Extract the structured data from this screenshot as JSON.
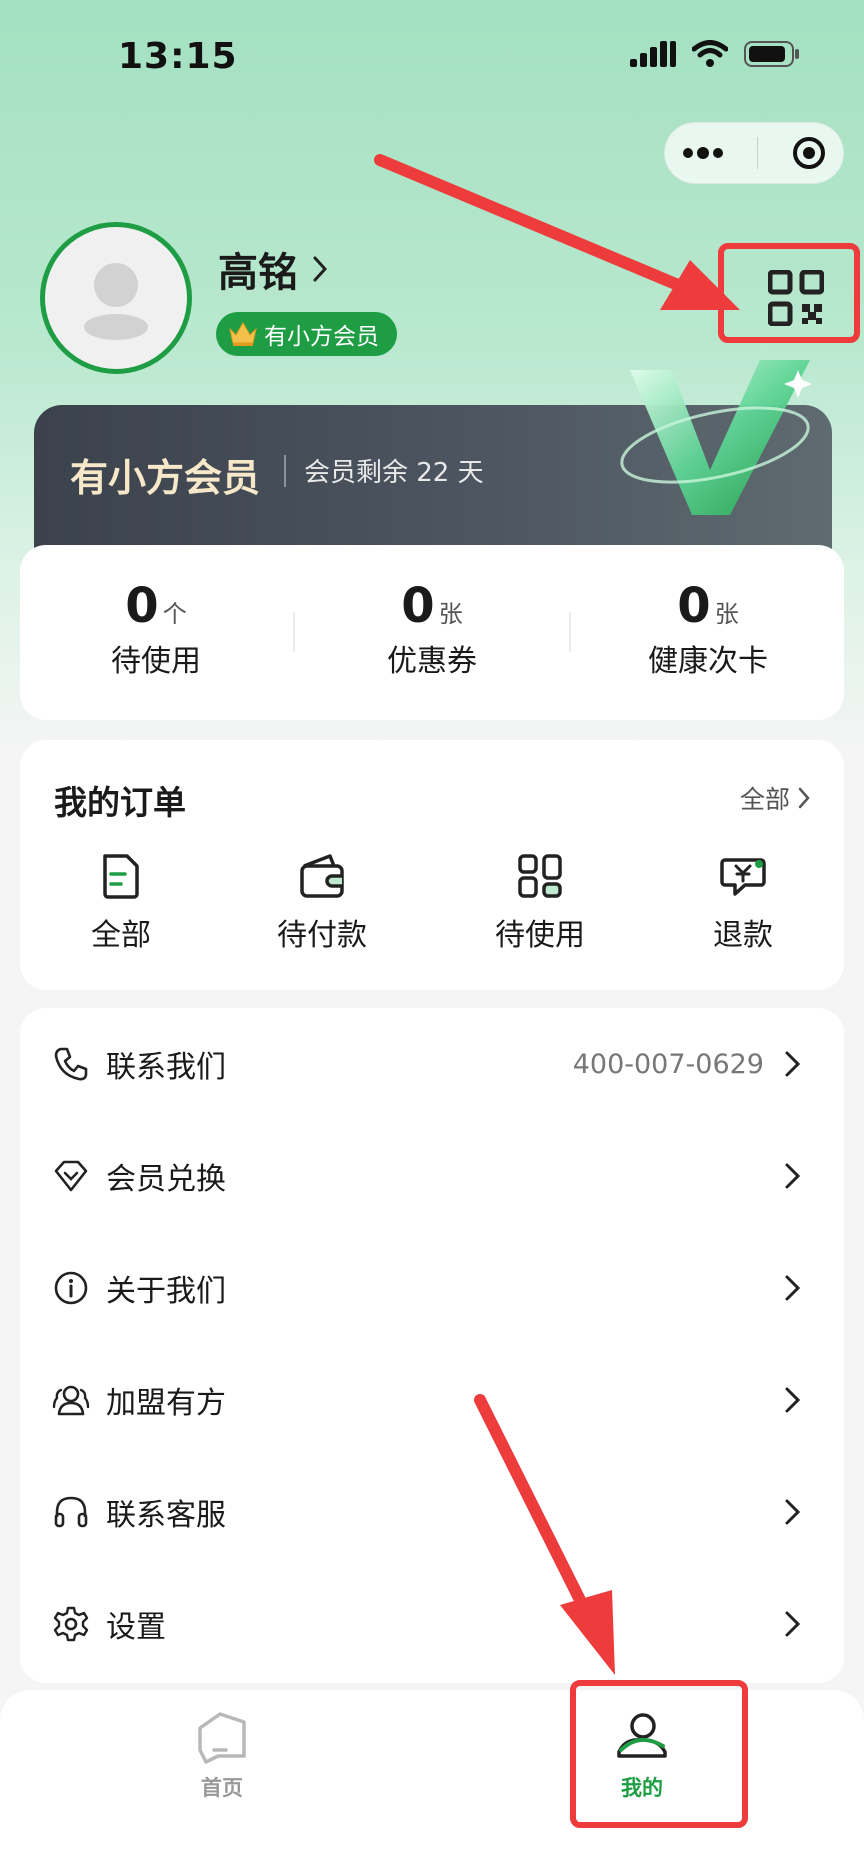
{
  "status_bar": {
    "time": "13:15"
  },
  "header": {
    "capsule_more_icon": "more-dots-icon",
    "capsule_close_icon": "target-close-icon"
  },
  "profile": {
    "name": "高铭",
    "member_badge": "有小方会员",
    "qr_icon": "qr-code-icon"
  },
  "member_card": {
    "title": "有小方会员",
    "remain_text": "会员剩余 22 天"
  },
  "stats": [
    {
      "value": "0",
      "unit": "个",
      "label": "待使用"
    },
    {
      "value": "0",
      "unit": "张",
      "label": "优惠券"
    },
    {
      "value": "0",
      "unit": "张",
      "label": "健康次卡"
    }
  ],
  "orders": {
    "title": "我的订单",
    "all_link": "全部",
    "items": [
      {
        "label": "全部",
        "icon": "document-icon"
      },
      {
        "label": "待付款",
        "icon": "wallet-icon"
      },
      {
        "label": "待使用",
        "icon": "grid-icon"
      },
      {
        "label": "退款",
        "icon": "refund-icon"
      }
    ]
  },
  "menu": [
    {
      "label": "联系我们",
      "value": "400-007-0629",
      "icon": "phone-icon"
    },
    {
      "label": "会员兑换",
      "value": "",
      "icon": "diamond-icon"
    },
    {
      "label": "关于我们",
      "value": "",
      "icon": "info-icon"
    },
    {
      "label": "加盟有方",
      "value": "",
      "icon": "people-icon"
    },
    {
      "label": "联系客服",
      "value": "",
      "icon": "headset-icon"
    },
    {
      "label": "设置",
      "value": "",
      "icon": "gear-icon"
    }
  ],
  "tabbar": [
    {
      "label": "首页",
      "icon": "home-icon",
      "active": false
    },
    {
      "label": "我的",
      "icon": "mine-icon",
      "active": true
    }
  ],
  "colors": {
    "brand_green": "#1e9d45",
    "annotation_red": "#ee3b3b"
  }
}
